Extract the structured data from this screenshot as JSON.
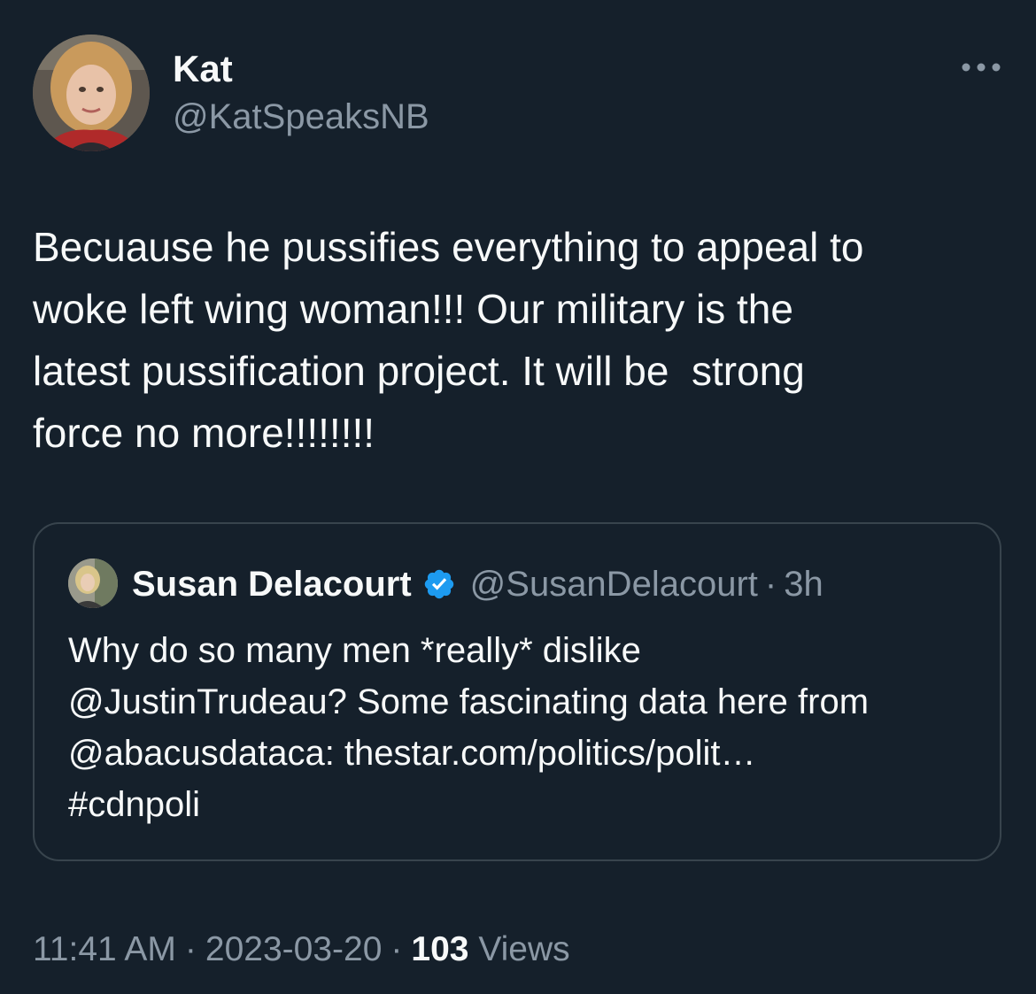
{
  "author": {
    "display_name": "Kat",
    "handle": "@KatSpeaksNB"
  },
  "tweet": {
    "text": "Becuause he pussifies everything to appeal to\nwoke left wing woman!!! Our military is the\nlatest pussification project. It will be  strong\nforce no more!!!!!!!!"
  },
  "quoted_tweet": {
    "display_name": "Susan Delacourt",
    "handle": "@SusanDelacourt",
    "separator": "·",
    "time": "3h",
    "text": "Why do so many men *really* dislike\n@JustinTrudeau? Some fascinating data here from\n@abacusdataca: thestar.com/politics/polit…\n#cdnpoli",
    "verified_icon": "verified-badge-icon"
  },
  "meta": {
    "time": "11:41 AM",
    "separator": "·",
    "date": "2023-03-20",
    "views_count": "103",
    "views_label": "Views"
  },
  "icons": {
    "more": "more-horizontal-icon"
  },
  "colors": {
    "background": "#15202b",
    "text_primary": "#f7f9f9",
    "text_secondary": "#8b98a5",
    "border": "#38444d",
    "verified": "#1d9bf0"
  }
}
